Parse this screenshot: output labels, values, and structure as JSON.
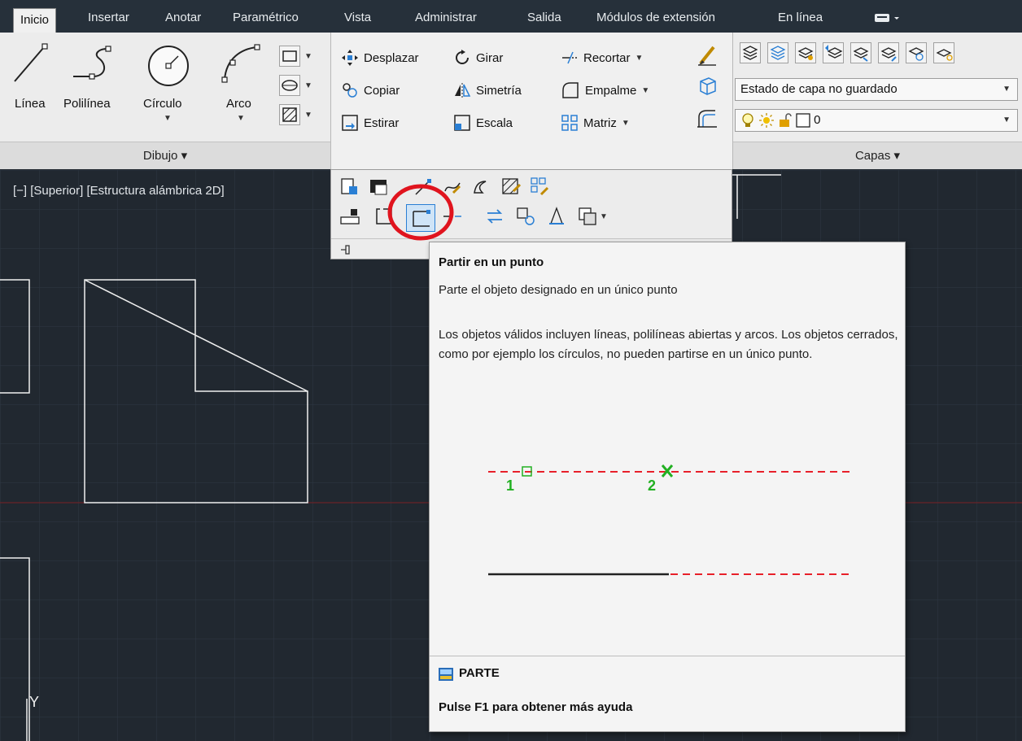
{
  "tabs": [
    "Inicio",
    "Insertar",
    "Anotar",
    "Paramétrico",
    "Vista",
    "Administrar",
    "Salida",
    "Módulos de extensión",
    "En línea"
  ],
  "draw_panel": {
    "line": "Línea",
    "polyline": "Polilínea",
    "circle": "Círculo",
    "arc": "Arco",
    "footer": "Dibujo ▾"
  },
  "modify_panel": {
    "move": "Desplazar",
    "rotate": "Girar",
    "trim": "Recortar",
    "copy": "Copiar",
    "mirror": "Simetría",
    "fillet": "Empalme",
    "stretch": "Estirar",
    "scale": "Escala",
    "array": "Matriz"
  },
  "layers_panel": {
    "state": "Estado de capa no guardado",
    "current_layer": "0",
    "footer": "Capas ▾"
  },
  "viewport": {
    "label": "[−] [Superior] [Estructura alámbrica 2D]",
    "ucs_y": "Y"
  },
  "tooltip": {
    "title": "Partir en un punto",
    "description": "Parte el objeto designado en un único punto",
    "detail": "Los objetos válidos incluyen líneas, polilíneas abiertas y arcos. Los objetos cerrados, como por ejemplo los círculos, no pueden partirse en un único punto.",
    "point_1": "1",
    "point_2": "2",
    "command": "PARTE",
    "help": "Pulse F1 para obtener más ayuda"
  },
  "colors": {
    "highlight_circle": "#e0141e",
    "selection_blue": "#2a7fd4",
    "dash_red": "#e8202a",
    "marker_green": "#22b022"
  }
}
